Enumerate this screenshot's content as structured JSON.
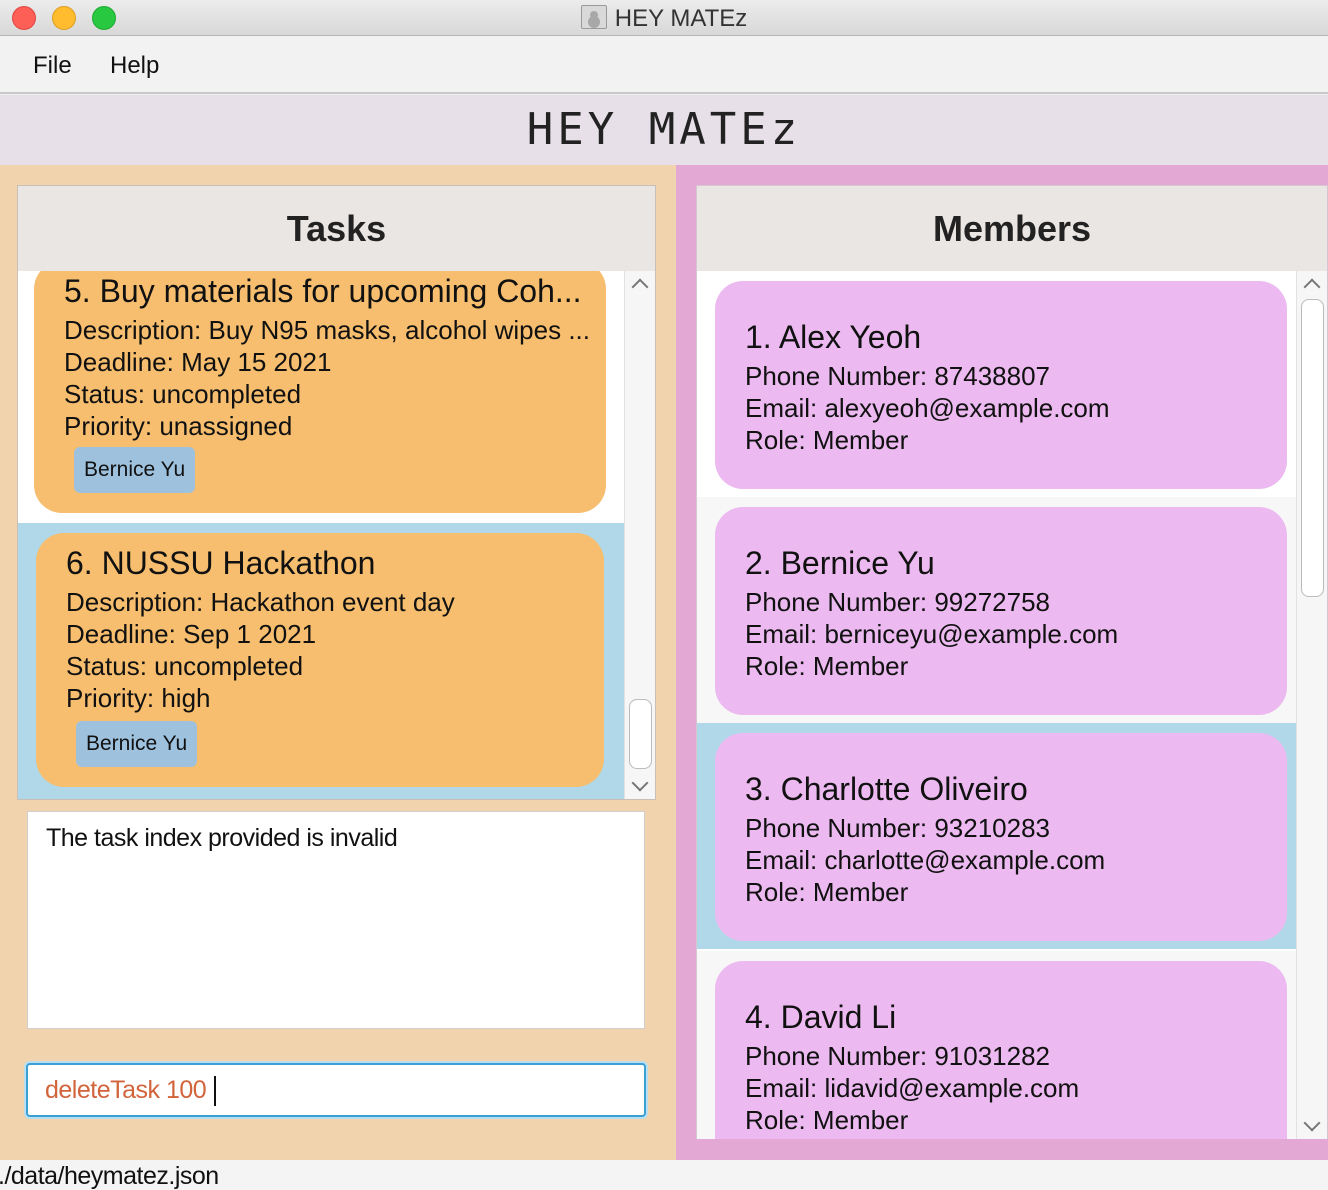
{
  "window": {
    "title": "HEY MATEz"
  },
  "menu": {
    "file": "File",
    "help": "Help"
  },
  "app": {
    "title": "HEY MATEz"
  },
  "tasks_panel": {
    "heading": "Tasks",
    "tasks": [
      {
        "title": "5.  Buy materials for upcoming Coh...",
        "description": "Description: Buy N95 masks, alcohol wipes ...",
        "deadline": "Deadline: May 15 2021",
        "status": "Status: uncompleted",
        "priority": "Priority: unassigned",
        "tag": "Bernice Yu",
        "selected": false
      },
      {
        "title": "6.  NUSSU Hackathon",
        "description": "Description: Hackathon event day",
        "deadline": "Deadline: Sep 1 2021",
        "status": "Status: uncompleted",
        "priority": "Priority: high",
        "tag": "Bernice Yu",
        "selected": true
      }
    ]
  },
  "result": {
    "text": "The task index provided is invalid"
  },
  "command": {
    "value": "deleteTask 100"
  },
  "members_panel": {
    "heading": "Members",
    "members": [
      {
        "title": "1.  Alex Yeoh",
        "phone": "Phone Number: 87438807",
        "email": "Email: alexyeoh@example.com",
        "role": "Role: Member",
        "selected": false
      },
      {
        "title": "2.  Bernice Yu",
        "phone": "Phone Number: 99272758",
        "email": "Email: berniceyu@example.com",
        "role": "Role: Member",
        "selected": false
      },
      {
        "title": "3.  Charlotte Oliveiro",
        "phone": "Phone Number: 93210283",
        "email": "Email: charlotte@example.com",
        "role": "Role: Member",
        "selected": true
      },
      {
        "title": "4.  David Li",
        "phone": "Phone Number: 91031282",
        "email": "Email: lidavid@example.com",
        "role": "Role: Member",
        "selected": false
      }
    ]
  },
  "status_bar": {
    "path": "./data/heymatez.json"
  },
  "colors": {
    "task_card": "#f6be6e",
    "member_card": "#ecbaf0",
    "tag": "#9ec2de",
    "selected_row": "#b0d8e8",
    "left_pane": "#f1d4ad",
    "right_pane": "#e3a8d4",
    "command_text": "#d2643c"
  }
}
